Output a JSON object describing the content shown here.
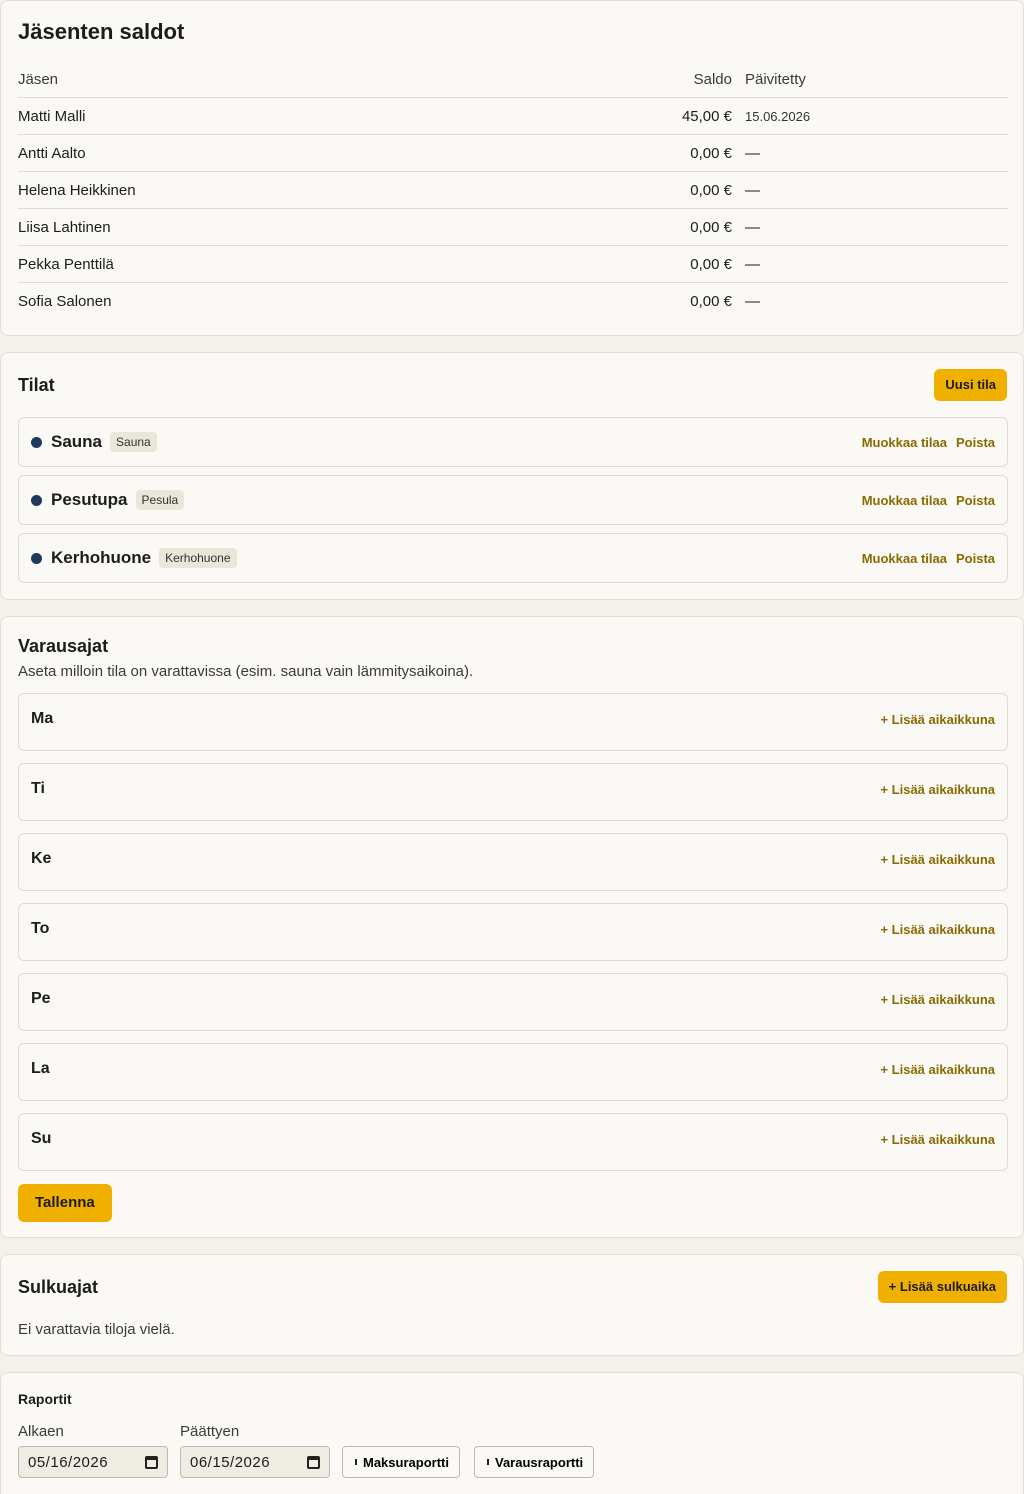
{
  "balances": {
    "title": "Jäsenten saldot",
    "columns": {
      "member": "Jäsen",
      "balance": "Saldo",
      "updated": "Päivitetty"
    },
    "rows": [
      {
        "member": "Matti Malli",
        "balance": "45,00 €",
        "updated": "15.06.2026"
      },
      {
        "member": "Antti Aalto",
        "balance": "0,00 €",
        "updated": "—"
      },
      {
        "member": "Helena Heikkinen",
        "balance": "0,00 €",
        "updated": "—"
      },
      {
        "member": "Liisa Lahtinen",
        "balance": "0,00 €",
        "updated": "—"
      },
      {
        "member": "Pekka Penttilä",
        "balance": "0,00 €",
        "updated": "—"
      },
      {
        "member": "Sofia Salonen",
        "balance": "0,00 €",
        "updated": "—"
      }
    ]
  },
  "spaces": {
    "title": "Tilat",
    "new_button": "Uusi tila",
    "edit_label": "Muokkaa tilaa",
    "delete_label": "Poista",
    "items": [
      {
        "name": "Sauna",
        "tag": "Sauna"
      },
      {
        "name": "Pesutupa",
        "tag": "Pesula"
      },
      {
        "name": "Kerhohuone",
        "tag": "Kerhohuone"
      }
    ]
  },
  "booking_times": {
    "title": "Varausajat",
    "description": "Aseta milloin tila on varattavissa (esim. sauna vain lämmitysaikoina).",
    "add_window_label": "+ Lisää aikaikkuna",
    "days": [
      "Ma",
      "Ti",
      "Ke",
      "To",
      "Pe",
      "La",
      "Su"
    ],
    "save_button": "Tallenna"
  },
  "closures": {
    "title": "Sulkuajat",
    "add_button": "+ Lisää sulkuaika",
    "empty_text": "Ei varattavia tiloja vielä."
  },
  "reports": {
    "title": "Raportit",
    "start_label": "Alkaen",
    "start_value": "05/16/2026",
    "end_label": "Päättyen",
    "end_value": "06/15/2026",
    "payment_report": "Maksuraportti",
    "booking_report": "Varausraportti"
  }
}
